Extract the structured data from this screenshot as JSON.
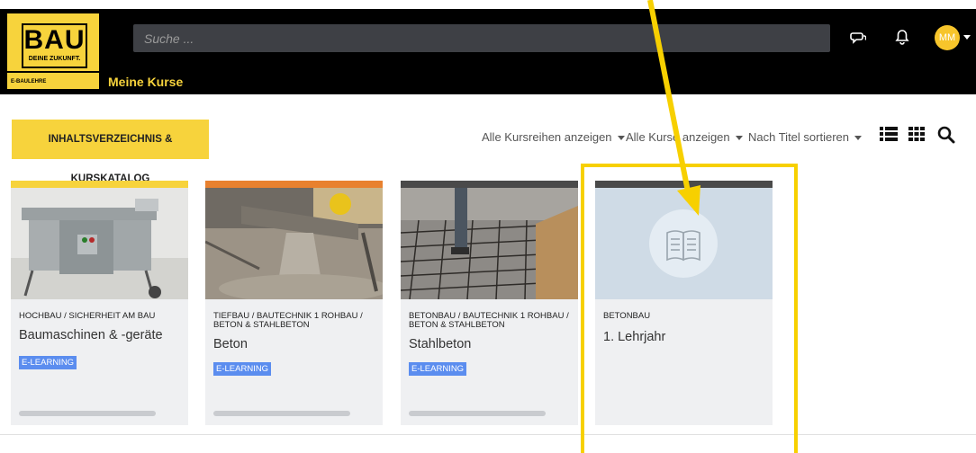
{
  "header": {
    "logo": {
      "word": "BAU",
      "tagline": "DEINE ZUKUNFT.",
      "sub": "E-BAULEHRE"
    },
    "search": {
      "placeholder": "Suche ..."
    },
    "nav_link": "Meine Kurse",
    "icons": [
      "chat-icon",
      "bell-icon"
    ],
    "avatar": {
      "initials": "MM"
    }
  },
  "toolbar": {
    "catalog_button": "INHALTSVERZEICHNIS & KURSKATALOG",
    "filters": {
      "course_series": "Alle Kursreihen anzeigen",
      "courses": "Alle Kurse anzeigen",
      "sort": "Nach Titel sortieren"
    },
    "view_icons": [
      "list-view-icon",
      "grid-view-icon",
      "search-icon"
    ]
  },
  "courses": [
    {
      "category": "HOCHBAU / SICHERHEIT AM BAU",
      "title": "Baumaschinen & -geräte",
      "badge": "E-LEARNING",
      "stripe_color": "#f7d33c",
      "progress": 0
    },
    {
      "category": "TIEFBAU / BAUTECHNIK 1 ROHBAU / BETON & STAHLBETON",
      "title": "Beton",
      "badge": "E-LEARNING",
      "stripe_color": "#e8812f",
      "progress": 0
    },
    {
      "category": "BETONBAU / BAUTECHNIK 1 ROHBAU / BETON & STAHLBETON",
      "title": "Stahlbeton",
      "badge": "E-LEARNING",
      "stripe_color": "#4a4a4a",
      "progress": 0
    },
    {
      "category": "BETONBAU",
      "title": "1. Lehrjahr",
      "badge": "",
      "stripe_color": "#4a4a4a",
      "progress": 0
    }
  ],
  "colors": {
    "brand_yellow": "#f7d33c",
    "badge_blue": "#5b8def",
    "annotation": "#f7d000"
  }
}
